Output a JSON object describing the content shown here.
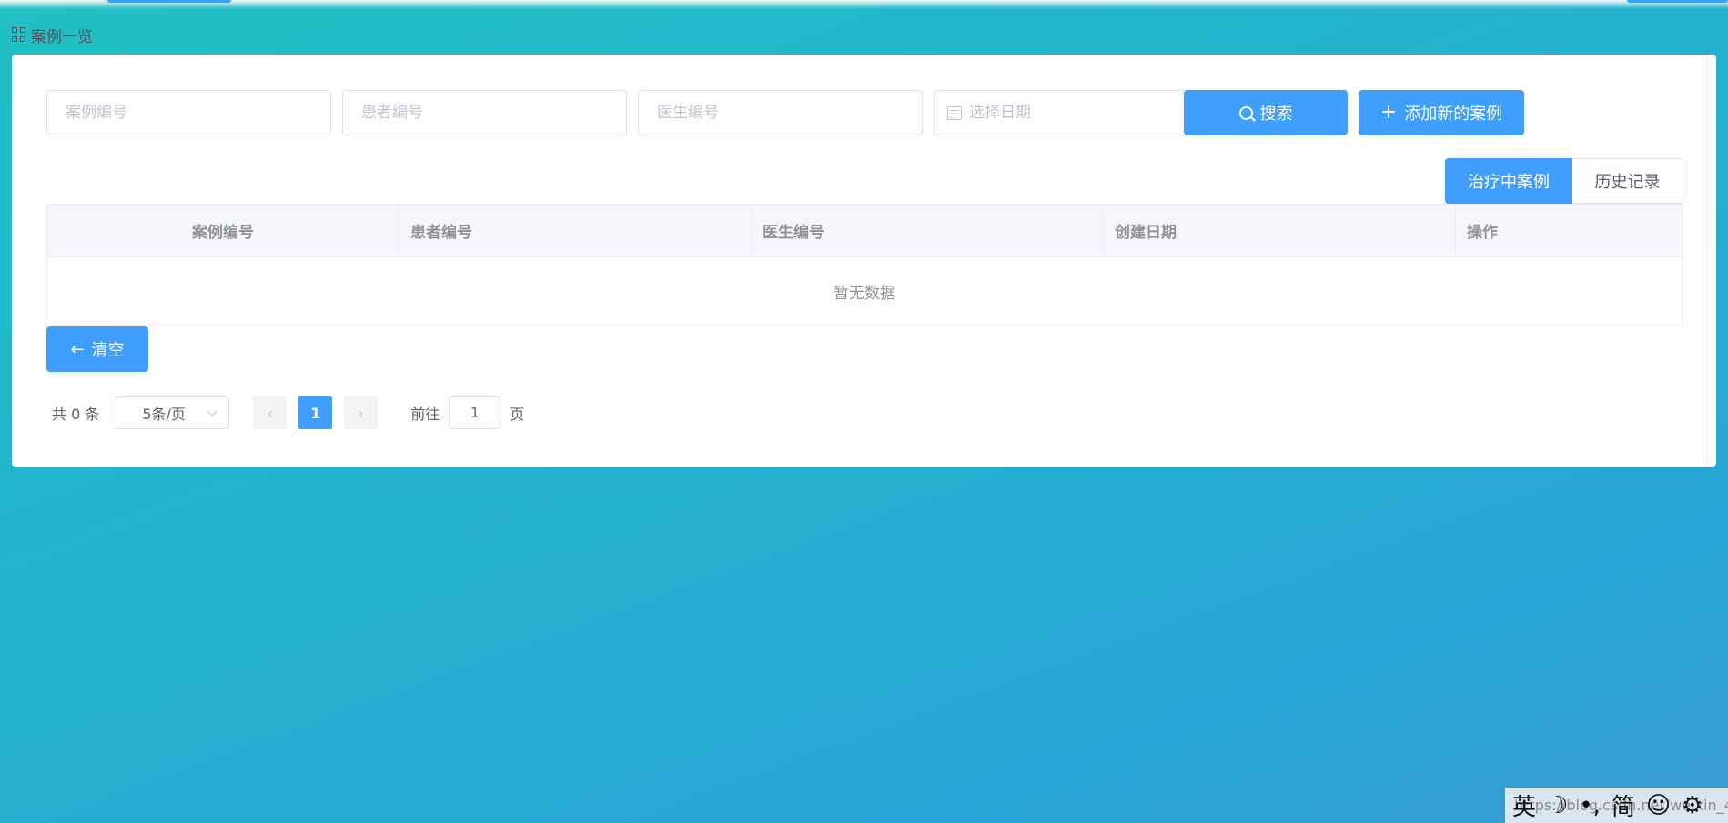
{
  "breadcrumb": {
    "title": "案例一览",
    "icon": "grid-icon"
  },
  "filters": {
    "case_no_placeholder": "案例编号",
    "patient_no_placeholder": "患者编号",
    "doctor_no_placeholder": "医生编号",
    "date_placeholder": "选择日期",
    "search_label": "搜索",
    "add_label": "添加新的案例"
  },
  "view_toggle": {
    "active": "治疗中案例",
    "other": "历史记录"
  },
  "table": {
    "columns": [
      "案例编号",
      "患者编号",
      "医生编号",
      "创建日期",
      "操作"
    ],
    "rows": [],
    "empty_text": "暂无数据"
  },
  "clear_label": "清空",
  "pagination": {
    "total_text": "共 0 条",
    "page_size": "5条/页",
    "current_page": "1",
    "prev_glyph": "‹",
    "next_glyph": "›",
    "goto_prefix": "前往",
    "goto_value": "1",
    "goto_suffix": "页"
  },
  "ime": {
    "lang": "英",
    "moon": "☽",
    "punct": "•,",
    "script": "简",
    "smile": "☺",
    "gear": "⚙",
    "watermark": "https://blog.csdn.net/weixin_4..."
  },
  "colors": {
    "primary": "#409eff",
    "bg_start": "#21c0c3",
    "bg_end": "#3a9ad0"
  }
}
